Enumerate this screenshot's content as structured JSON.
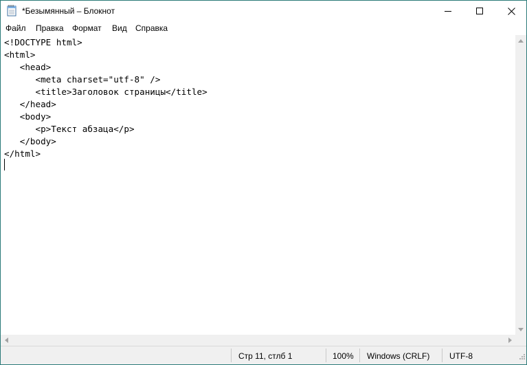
{
  "window": {
    "title": "*Безымянный – Блокнот",
    "controls": {
      "minimize": "minimize-icon",
      "maximize": "maximize-icon",
      "close": "close-icon"
    }
  },
  "menu": [
    "Файл",
    "Правка",
    "Формат",
    "Вид",
    "Справка"
  ],
  "editor": {
    "content": "<!DOCTYPE html>\n<html>\n   <head>\n      <meta charset=\"utf-8\" />\n      <title>Заголовок страницы</title>\n   </head>\n   <body>\n      <p>Текст абзаца</p>\n   </body>\n</html>\n"
  },
  "status": {
    "position": "Стр 11, стлб 1",
    "zoom": "100%",
    "line_endings": "Windows (CRLF)",
    "encoding": "UTF-8"
  }
}
